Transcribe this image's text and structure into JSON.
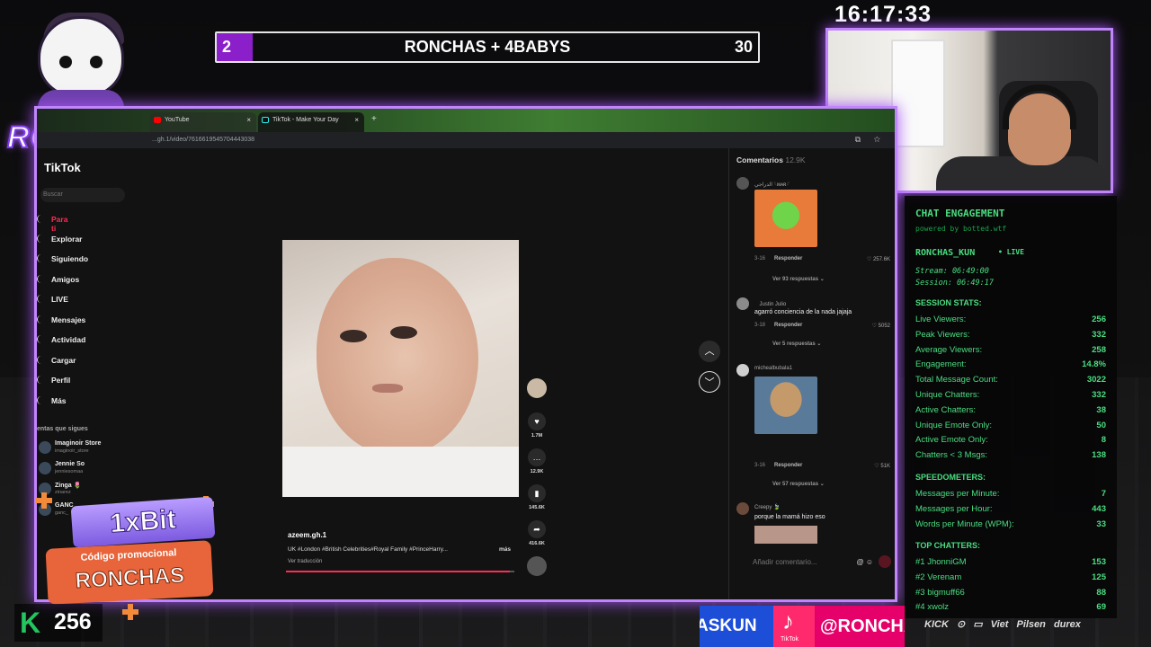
{
  "overlay": {
    "clock": "16:17:33",
    "scoreboard": {
      "left_score": "2",
      "title": "RONCHAS + 4BABYS",
      "right_score": "30"
    },
    "logo_text": "RONCHAS",
    "kick_count": "256",
    "promo": {
      "brand": "1xBit",
      "line1": "Código promocional",
      "line2": "RONCHAS"
    },
    "bottom_banner": {
      "left_text": "ASKUN",
      "tiktok_label": "TikTok",
      "right_text": "@RONCHA"
    },
    "sponsors": "KICK ⊙ ▭ Viet Pilsen durex"
  },
  "browser": {
    "tabs": [
      {
        "label": "YouTube",
        "icon": "youtube-icon"
      },
      {
        "label": "TikTok - Make Your Day",
        "icon": "tiktok-icon"
      }
    ],
    "url": "...gh.1/video/7616619545704443038"
  },
  "tiktok": {
    "logo": "TikTok",
    "search_placeholder": "Buscar",
    "nav": [
      "Para ti",
      "Explorar",
      "Siguiendo",
      "Amigos",
      "LIVE",
      "Mensajes",
      "Actividad",
      "Cargar",
      "Perfil",
      "Más"
    ],
    "following_title": "entas que sigues",
    "following": [
      {
        "name": "Imaginoir Store",
        "handle": "imaginoir_store"
      },
      {
        "name": "Jennie So",
        "handle": "jenniesomaa"
      },
      {
        "name": "Zinga 🌷",
        "handle": "zinarez"
      },
      {
        "name": "GANC",
        "handle": "ganc_"
      }
    ],
    "actions": {
      "likes": "1.7M",
      "comments": "12.9K",
      "saves": "145.6K",
      "shares": "416.6K"
    },
    "video": {
      "username": "azeem.gh.1",
      "description": "UK #London #British Celebrities#Royal Family #PrinceHarry...",
      "more": "más",
      "translate": "Ver traducción",
      "progress": 0.98
    },
    "comments": {
      "title": "Comentarios",
      "count": "12.9K",
      "items": [
        {
          "user": "الدراجي 𓆩ᴍᴀʀ𓆪",
          "text": "",
          "date": "3-16",
          "reply": "Responder",
          "likes": "257.6K",
          "view_replies": "Ver 93 respuestas"
        },
        {
          "user": "ﾠJustin Julioﾠ",
          "text": "agarró conciencia de la nada jajaja",
          "date": "3-18",
          "reply": "Responder",
          "likes": "5052",
          "view_replies": "Ver 5 respuestas"
        },
        {
          "user": "michealbubala1",
          "text": "",
          "date": "3-16",
          "reply": "Responder",
          "likes": "51K",
          "view_replies": "Ver 57 respuestas"
        },
        {
          "user": "Creepy 🍃",
          "text": "porque la mamá hizo eso"
        }
      ],
      "input_placeholder": "Añadir comentario..."
    }
  },
  "stats": {
    "title": "CHAT ENGAGEMENT",
    "powered": "powered by botted.wtf",
    "channel": "RONCHAS_KUN",
    "live": "• LIVE",
    "stream": "Stream: 06:49:00",
    "session": "Session: 06:49:17",
    "session_title": "SESSION STATS:",
    "session_rows": [
      {
        "label": "Live Viewers:",
        "value": "256"
      },
      {
        "label": "Peak Viewers:",
        "value": "332"
      },
      {
        "label": "Average Viewers:",
        "value": "258"
      },
      {
        "label": "Engagement:",
        "value": "14.8%"
      },
      {
        "label": "Total Message Count:",
        "value": "3022"
      },
      {
        "label": "Unique Chatters:",
        "value": "332"
      },
      {
        "label": "Active Chatters:",
        "value": "38"
      },
      {
        "label": "Unique Emote Only:",
        "value": "50"
      },
      {
        "label": "Active Emote Only:",
        "value": "8"
      },
      {
        "label": "Chatters < 3 Msgs:",
        "value": "138"
      }
    ],
    "speed_title": "SPEEDOMETERS:",
    "speed_rows": [
      {
        "label": "Messages per Minute:",
        "value": "7"
      },
      {
        "label": "Messages per Hour:",
        "value": "443"
      },
      {
        "label": "Words per Minute (WPM):",
        "value": "33"
      }
    ],
    "top_title": "TOP CHATTERS:",
    "top_rows": [
      {
        "label": "#1 JhonniGM",
        "value": "153"
      },
      {
        "label": "#2 Verenam",
        "value": "125"
      },
      {
        "label": "#3 bigmuff66",
        "value": "88"
      },
      {
        "label": "#4 xwolz",
        "value": "69"
      }
    ]
  }
}
